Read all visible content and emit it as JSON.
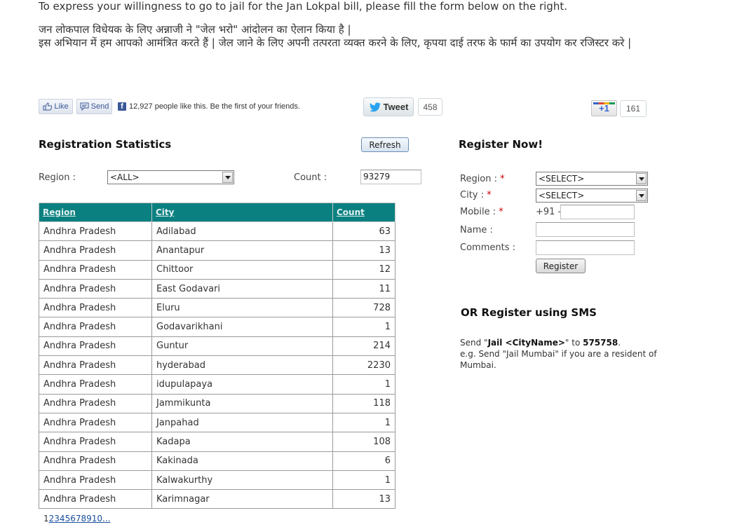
{
  "intro": {
    "english": "To express your willingness to go to jail for the Jan Lokpal bill, please fill the form below on the right.",
    "hindi_line1": "जन लोकपाल विधेयक के लिए अन्नाजी ने \"जेल भरो\" आंदोलन का ऐलान किया है |",
    "hindi_line2": "इस अभियान में हम आपको आमंत्रित करते हैं |  जेल जाने के लिए अपनी तत्परता व्यक्त करने के लिए, कृपया दाई तरफ के फार्म का उपयोग कर रजिस्टर करे |"
  },
  "social": {
    "like_label": "Like",
    "send_label": "Send",
    "fb_icon": "f",
    "fb_text": "12,927 people like this. Be the first of your friends.",
    "tweet_label": "Tweet",
    "tweet_count": "458",
    "plusone_label": "+1",
    "plusone_count": "161"
  },
  "stats": {
    "heading": "Registration Statistics",
    "refresh_label": "Refresh",
    "region_label": "Region :",
    "region_value": "<ALL>",
    "count_label": "Count :",
    "count_value": "93279",
    "columns": [
      "Region",
      "City",
      "Count"
    ],
    "rows": [
      [
        "Andhra Pradesh",
        "Adilabad",
        "63"
      ],
      [
        "Andhra Pradesh",
        "Anantapur",
        "13"
      ],
      [
        "Andhra Pradesh",
        "Chittoor",
        "12"
      ],
      [
        "Andhra Pradesh",
        "East Godavari",
        "11"
      ],
      [
        "Andhra Pradesh",
        "Eluru",
        "728"
      ],
      [
        "Andhra Pradesh",
        "Godavarikhani",
        "1"
      ],
      [
        "Andhra Pradesh",
        "Guntur",
        "214"
      ],
      [
        "Andhra Pradesh",
        "hyderabad",
        "2230"
      ],
      [
        "Andhra Pradesh",
        "idupulapaya",
        "1"
      ],
      [
        "Andhra Pradesh",
        "Jammikunta",
        "118"
      ],
      [
        "Andhra Pradesh",
        "Janpahad",
        "1"
      ],
      [
        "Andhra Pradesh",
        "Kadapa",
        "108"
      ],
      [
        "Andhra Pradesh",
        "Kakinada",
        "6"
      ],
      [
        "Andhra Pradesh",
        "Kalwakurthy",
        "1"
      ],
      [
        "Andhra Pradesh",
        "Karimnagar",
        "13"
      ]
    ],
    "pager": {
      "current": "1",
      "pages": [
        "2",
        "3",
        "4",
        "5",
        "6",
        "7",
        "8",
        "9",
        "10",
        "..."
      ]
    }
  },
  "register": {
    "heading": "Register Now!",
    "region_label": "Region :",
    "region_value": "<SELECT>",
    "city_label": "City :",
    "city_value": "<SELECT>",
    "mobile_label": "Mobile :",
    "mobile_prefix": "+91 -",
    "mobile_value": "",
    "name_label": "Name :",
    "name_value": "",
    "comments_label": "Comments :",
    "comments_value": "",
    "required_mark": "*",
    "submit_label": "Register"
  },
  "sms": {
    "heading": "OR Register using SMS",
    "send_word": "Send \"",
    "keyword": "Jail <CityName>",
    "to_word": "\" to ",
    "number": "575758",
    "period": ".",
    "example": "e.g. Send \"Jail Mumbai\" if you are a resident of Mumbai."
  },
  "colors": {
    "table_header_bg": "#0b8080",
    "link": "#1a4fa0",
    "required": "#cc0000"
  }
}
